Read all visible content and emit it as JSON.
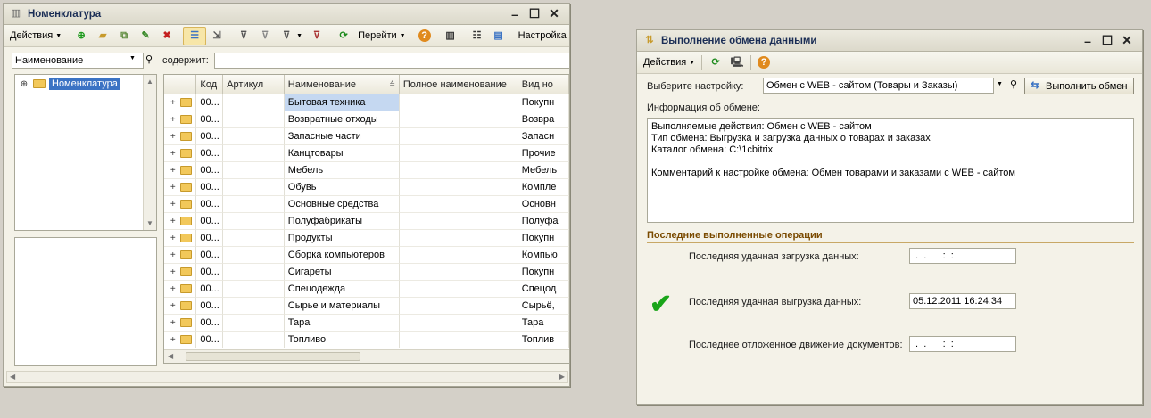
{
  "left_window": {
    "title": "Номенклатура",
    "toolbar": {
      "actions_label": "Действия",
      "goto_label": "Перейти",
      "access_label": "Настройка досту"
    },
    "filter": {
      "field_value": "Наименование",
      "contains_label": "содержит:",
      "search_value": ""
    },
    "tree": {
      "root_label": "Номенклатура"
    },
    "grid": {
      "columns": [
        "Код",
        "Артикул",
        "Наименование",
        "Полное наименование",
        "Вид но"
      ],
      "rows": [
        {
          "code": "00...",
          "article": "",
          "name": "Бытовая техника",
          "full_name": "",
          "type": "Покупн"
        },
        {
          "code": "00...",
          "article": "",
          "name": "Возвратные отходы",
          "full_name": "",
          "type": "Возвра"
        },
        {
          "code": "00...",
          "article": "",
          "name": "Запасные части",
          "full_name": "",
          "type": "Запасн"
        },
        {
          "code": "00...",
          "article": "",
          "name": "Канцтовары",
          "full_name": "",
          "type": "Прочие"
        },
        {
          "code": "00...",
          "article": "",
          "name": "Мебель",
          "full_name": "",
          "type": "Мебель"
        },
        {
          "code": "00...",
          "article": "",
          "name": "Обувь",
          "full_name": "",
          "type": "Компле"
        },
        {
          "code": "00...",
          "article": "",
          "name": "Основные средства",
          "full_name": "",
          "type": "Основн"
        },
        {
          "code": "00...",
          "article": "",
          "name": "Полуфабрикаты",
          "full_name": "",
          "type": "Полуфа"
        },
        {
          "code": "00...",
          "article": "",
          "name": "Продукты",
          "full_name": "",
          "type": "Покупн"
        },
        {
          "code": "00...",
          "article": "",
          "name": "Сборка компьютеров",
          "full_name": "",
          "type": "Компью"
        },
        {
          "code": "00...",
          "article": "",
          "name": "Сигареты",
          "full_name": "",
          "type": "Покупн"
        },
        {
          "code": "00...",
          "article": "",
          "name": "Спецодежда",
          "full_name": "",
          "type": "Спецод"
        },
        {
          "code": "00...",
          "article": "",
          "name": "Сырье и материалы",
          "full_name": "",
          "type": "Сырьё,"
        },
        {
          "code": "00...",
          "article": "",
          "name": "Тара",
          "full_name": "",
          "type": "Тара"
        },
        {
          "code": "00...",
          "article": "",
          "name": "Топливо",
          "full_name": "",
          "type": "Топлив"
        }
      ]
    }
  },
  "right_window": {
    "title": "Выполнение обмена данными",
    "toolbar": {
      "actions_label": "Действия"
    },
    "select_label": "Выберите настройку:",
    "select_value": "Обмен с WEB - сайтом (Товары и Заказы)",
    "execute_button": "Выполнить обмен",
    "info_label": "Информация об обмене:",
    "info_lines": [
      "Выполняемые действия: Обмен с WEB - сайтом",
      "Тип обмена:  Выгрузка и загрузка данных о товарах и заказах",
      "Каталог обмена: C:\\1cbitrix",
      "",
      "Комментарий к настройке обмена: Обмен товарами и заказами с WEB - сайтом"
    ],
    "section_title": "Последние выполненные операции",
    "ops": {
      "last_load_label": "Последняя удачная загрузка данных:",
      "last_load_value": " .  .      :  :",
      "last_unload_label": "Последняя удачная выгрузка данных:",
      "last_unload_value": "05.12.2011 16:24:34",
      "deferred_label": "Последнее отложенное движение документов:",
      "deferred_value": " .  .      :  :"
    }
  },
  "colors": {
    "selection": "#c5d8f1",
    "tree_selection": "#3b73c4",
    "check_green": "#19a519",
    "section_text": "#7a4a00"
  }
}
